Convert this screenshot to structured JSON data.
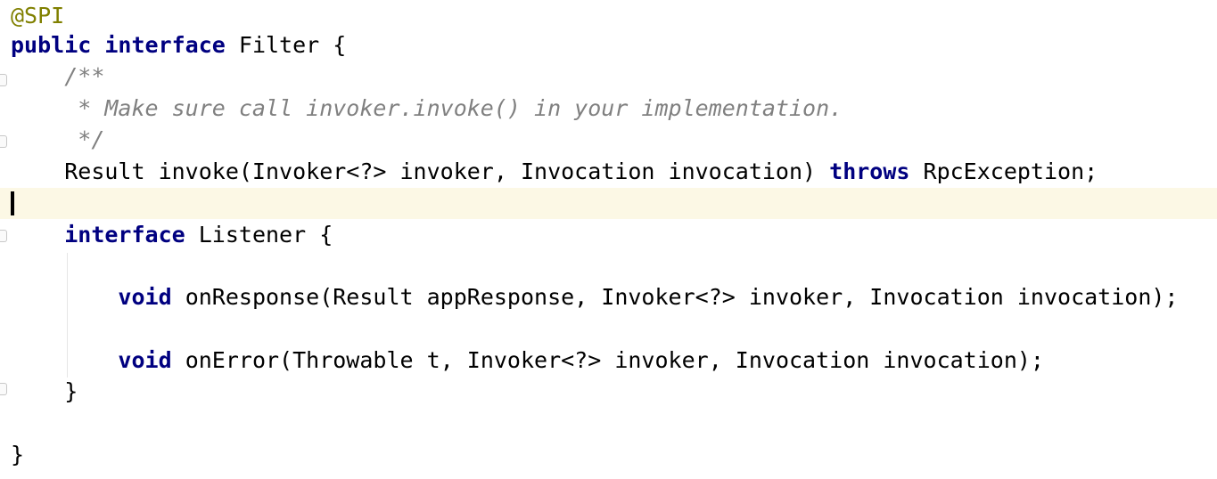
{
  "code": {
    "annotation": "@SPI",
    "l2_kw1": "public",
    "l2_kw2": "interface",
    "l2_rest": " Filter {",
    "c1": "/**",
    "c2": " * Make sure call invoker.invoke() in your implementation.",
    "c3": " */",
    "l6_a": "Result invoke(Invoker<?> invoker, Invocation invocation) ",
    "l6_kw": "throws",
    "l6_b": " RpcException;",
    "l8_kw": "interface",
    "l8_rest": " Listener {",
    "l10_kw": "void",
    "l10_rest": " onResponse(Result appResponse, Invoker<?> invoker, Invocation invocation);",
    "l12_kw": "void",
    "l12_rest": " onError(Throwable t, Invoker<?> invoker, Invocation invocation);",
    "l13": "}",
    "l15": "}"
  },
  "colors": {
    "keyword": "#000080",
    "annotation": "#808000",
    "comment": "#808080",
    "current_line": "#fcf8e5"
  }
}
